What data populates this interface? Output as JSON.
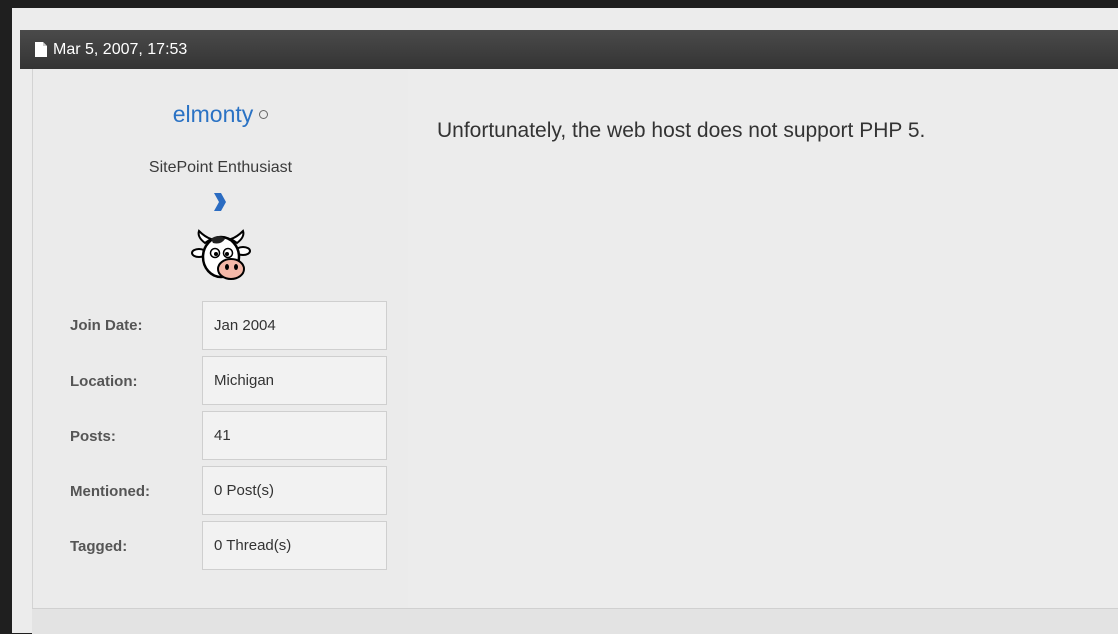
{
  "post": {
    "date": "Mar 5, 2007, 17:53",
    "message": "Unfortunately, the web host does not support PHP 5."
  },
  "user": {
    "username": "elmonty",
    "title": "SitePoint Enthusiast",
    "status": "offline",
    "avatar": "cow-avatar",
    "rank_icon": "chevron-rank-icon"
  },
  "userinfo": [
    {
      "label": "Join Date:",
      "value": "Jan 2004"
    },
    {
      "label": "Location:",
      "value": "Michigan"
    },
    {
      "label": "Posts:",
      "value": "41"
    },
    {
      "label": "Mentioned:",
      "value": "0 Post(s)"
    },
    {
      "label": "Tagged:",
      "value": "0 Thread(s)"
    }
  ],
  "colors": {
    "header_bg": "#3a3a3a",
    "username": "#2a72c4",
    "rank_icon": "#2b6cc2",
    "page_bg": "#ececec"
  }
}
